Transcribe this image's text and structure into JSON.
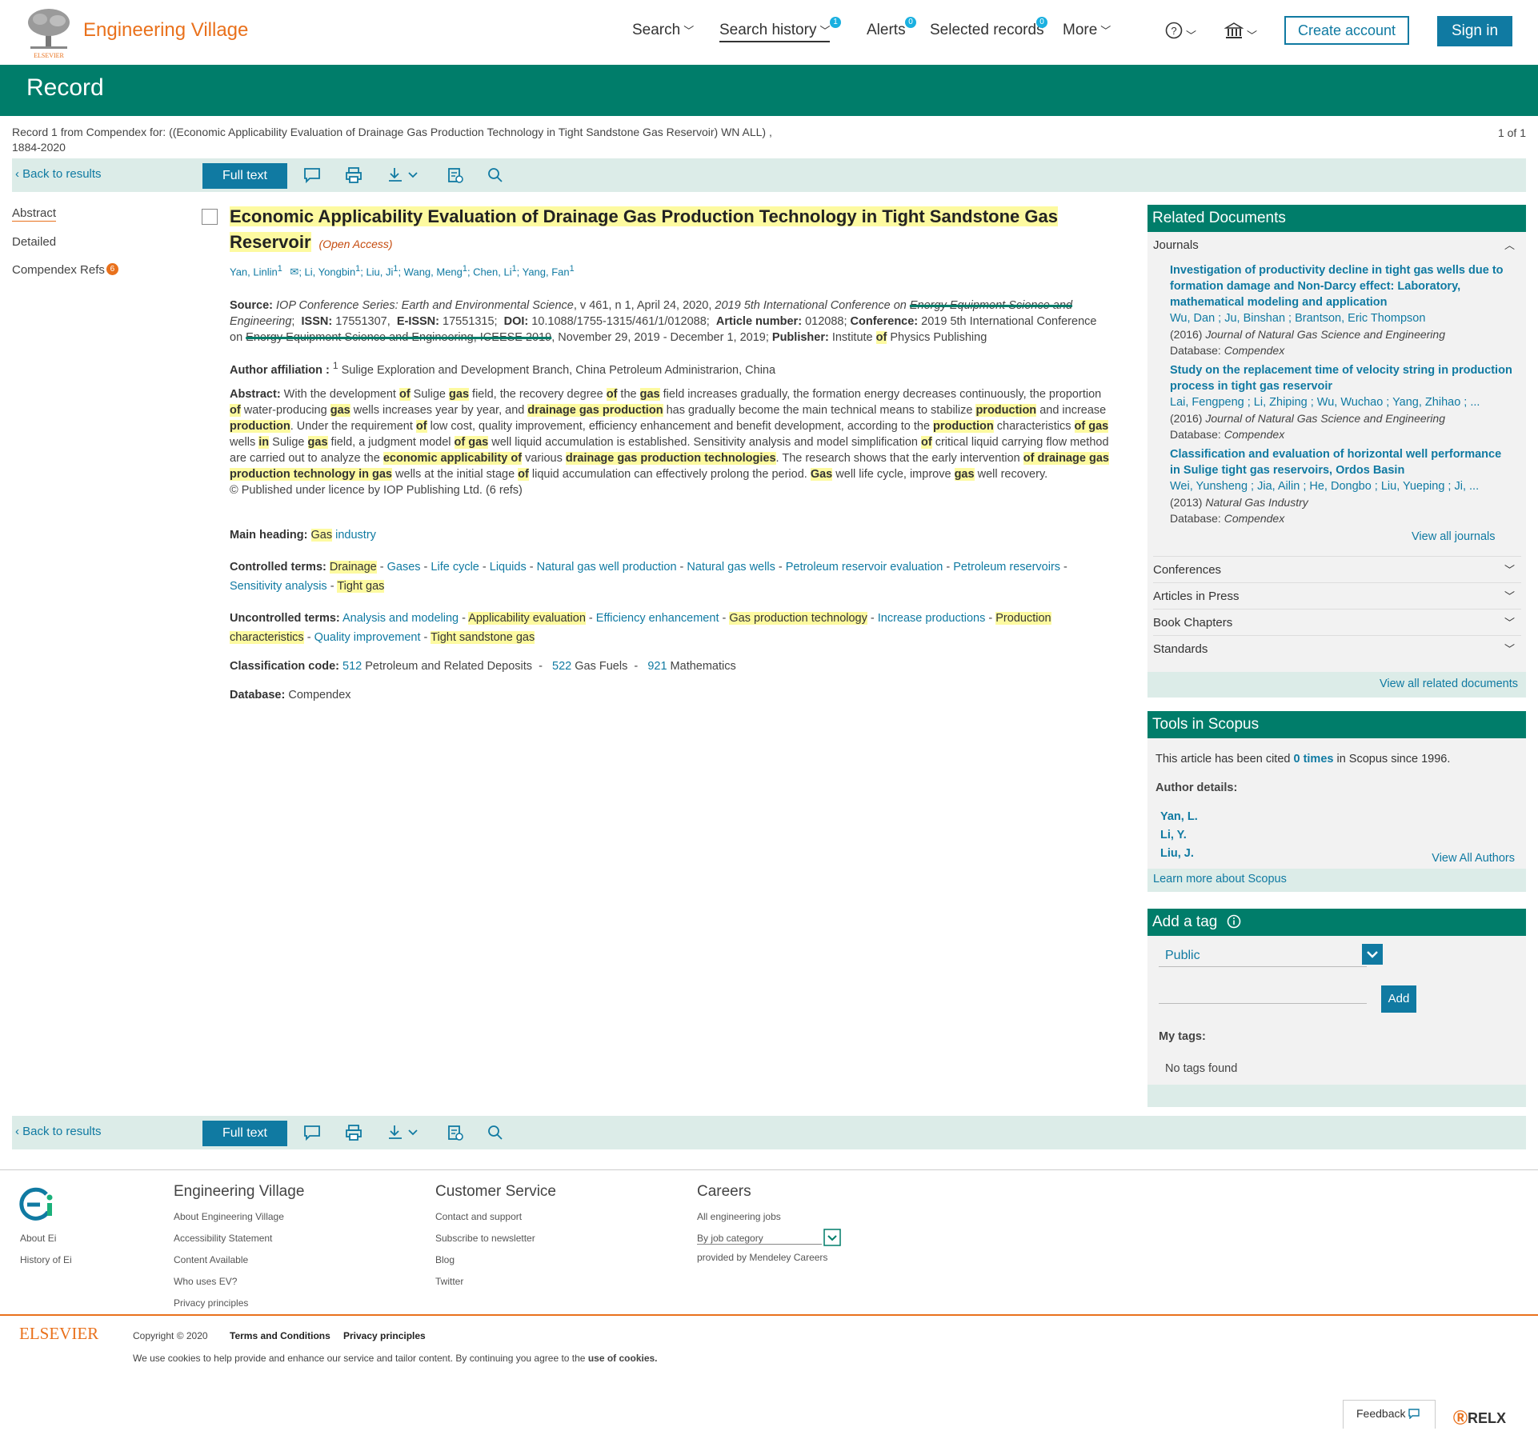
{
  "header": {
    "brand": "Engineering Village",
    "publisher_logo": "ELSEVIER",
    "nav": {
      "search": "Search",
      "search_history": "Search history",
      "search_history_badge": "1",
      "alerts": "Alerts",
      "alerts_badge": "0",
      "selected_records": "Selected records",
      "selected_badge": "0",
      "more": "More"
    },
    "create_account": "Create account",
    "sign_in": "Sign in"
  },
  "banner": {
    "title": "Record"
  },
  "record_info": {
    "text": "Record 1 from Compendex for: ((Economic Applicability Evaluation of Drainage Gas Production Technology in Tight Sandstone Gas Reservoir) WN ALL) , 1884-2020",
    "count": "1 of 1"
  },
  "toolbar": {
    "back": "Back to results",
    "full_text": "Full text"
  },
  "left_nav": {
    "abstract": "Abstract",
    "detailed": "Detailed",
    "refs": "Compendex Refs",
    "refs_count": "6"
  },
  "record": {
    "title_part1": "Economic Applicability Evaluation of Drainage Gas Production Technology in Tight Sandstone Gas",
    "title_part2": "Reservoir",
    "open_access": "(Open Access)",
    "authors": [
      "Yan, Linlin",
      "Li, Yongbin",
      "Liu, Ji",
      "Wang, Meng",
      "Chen, Li",
      "Yang, Fan"
    ],
    "source_label": "Source:",
    "source_journal": "IOP Conference Series: Earth and Environmental Science",
    "source_vol": ", v 461, n 1, April 24, 2020, ",
    "source_conf_italic": "2019 5th International Conference on ",
    "source_conf_struck": "Energy Equipment Science and",
    "source_conf_italic2": "Engineering",
    "issn_label": "ISSN:",
    "issn": "17551307",
    "eissn_label": "E-ISSN:",
    "eissn": "17551315",
    "doi_label": "DOI:",
    "doi": "10.1088/1755-1315/461/1/012088",
    "article_label": "Article number:",
    "article_number": "012088",
    "conference_label": "Conference:",
    "conference": "2019 5th International Conference on",
    "conference_struck": "Energy Equipment Science and Engineering, ICEESE 2019",
    "conference_dates": ", November 29, 2019 - December 1, 2019;",
    "publisher_label": "Publisher:",
    "publisher": "Institute of Physics Publishing",
    "affiliation_label": "Author affiliation :",
    "affiliation": "Sulige Exploration and Development Branch, China Petroleum Administrarion, China",
    "abstract_label": "Abstract:",
    "licence": "© Published under licence by IOP Publishing Ltd. (6 refs)",
    "main_heading_label": "Main heading:",
    "main_heading": "Gas industry",
    "controlled_label": "Controlled terms:",
    "controlled_terms": [
      "Drainage",
      "Gases",
      "Life cycle",
      "Liquids",
      "Natural gas well production",
      "Natural gas wells",
      "Petroleum reservoir evaluation",
      "Petroleum reservoirs",
      "Sensitivity analysis",
      "Tight gas"
    ],
    "uncontrolled_label": "Uncontrolled terms:",
    "uncontrolled_terms": [
      "Analysis and modeling",
      "Applicability evaluation",
      "Efficiency enhancement",
      "Gas production technology",
      "Increase productions",
      "Production characteristics",
      "Quality improvement",
      "Tight sandstone gas"
    ],
    "classification_label": "Classification code:",
    "classification": [
      {
        "code": "512",
        "label": "Petroleum and Related Deposits"
      },
      {
        "code": "522",
        "label": "Gas Fuels"
      },
      {
        "code": "921",
        "label": "Mathematics"
      }
    ],
    "database_label": "Database:",
    "database": "Compendex"
  },
  "related": {
    "heading": "Related Documents",
    "journals_label": "Journals",
    "items": [
      {
        "title": "Investigation of productivity decline in tight gas wells due to formation damage and Non-Darcy effect: Laboratory, mathematical modeling and application",
        "authors": "Wu, Dan ; Ju, Binshan ; Brantson, Eric Thompson",
        "year": "(2016)",
        "journal": "Journal of Natural Gas Science and Engineering",
        "db_label": "Database:",
        "db": "Compendex"
      },
      {
        "title": "Study on the replacement time of velocity string in production process in tight gas reservoir",
        "authors": "Lai, Fengpeng ; Li, Zhiping ; Wu, Wuchao ; Yang, Zhihao ; ...",
        "year": "(2016)",
        "journal": "Journal of Natural Gas Science and Engineering",
        "db_label": "Database:",
        "db": "Compendex"
      },
      {
        "title": "Classification and evaluation of horizontal well performance in Sulige tight gas reservoirs, Ordos Basin",
        "authors": "Wei, Yunsheng ; Jia, Ailin ; He, Dongbo ; Liu, Yueping ; Ji, ...",
        "year": "(2013)",
        "journal": "Natural Gas Industry",
        "db_label": "Database:",
        "db": "Compendex"
      }
    ],
    "view_all_journals": "View all journals",
    "conferences": "Conferences",
    "articles_in_press": "Articles in Press",
    "book_chapters": "Book Chapters",
    "standards": "Standards",
    "view_all_related": "View all related documents"
  },
  "scopus": {
    "heading": "Tools in Scopus",
    "cited_pre": "This article has been cited ",
    "cited_times": "0 times",
    "cited_post": " in Scopus since 1996.",
    "author_details": "Author details:",
    "authors": [
      "Yan, L.",
      "Li, Y.",
      "Liu, J."
    ],
    "view_all_authors": "View All Authors",
    "learn_more": "Learn more about Scopus"
  },
  "tag": {
    "heading": "Add a tag",
    "select_value": "Public",
    "add_button": "Add",
    "my_tags": "My tags:",
    "no_tags": "No tags found"
  },
  "footer": {
    "ei_links": [
      "About Ei",
      "History of Ei"
    ],
    "col1_title": "Engineering Village",
    "col1_links": [
      "About Engineering Village",
      "Accessibility Statement",
      "Content Available",
      "Who uses EV?",
      "Privacy principles"
    ],
    "col2_title": "Customer Service",
    "col2_links": [
      "Contact and support",
      "Subscribe to newsletter",
      "Blog",
      "Twitter"
    ],
    "col3_title": "Careers",
    "col3_links": [
      "All engineering jobs",
      "By job category",
      "provided by Mendeley Careers"
    ],
    "elsevier": "ELSEVIER",
    "copyright": "Copyright © 2020",
    "terms": "Terms and Conditions",
    "privacy": "Privacy principles",
    "cookies_pre": "We use cookies to help provide and enhance our service and tailor content. By continuing you agree to the ",
    "cookies_link": "use of cookies.",
    "feedback": "Feedback",
    "relx": "RELX"
  },
  "colors": {
    "brand_orange": "#e9711c",
    "teal": "#007d6a",
    "link_blue": "#107aa2",
    "highlight": "#fdfaa0"
  }
}
